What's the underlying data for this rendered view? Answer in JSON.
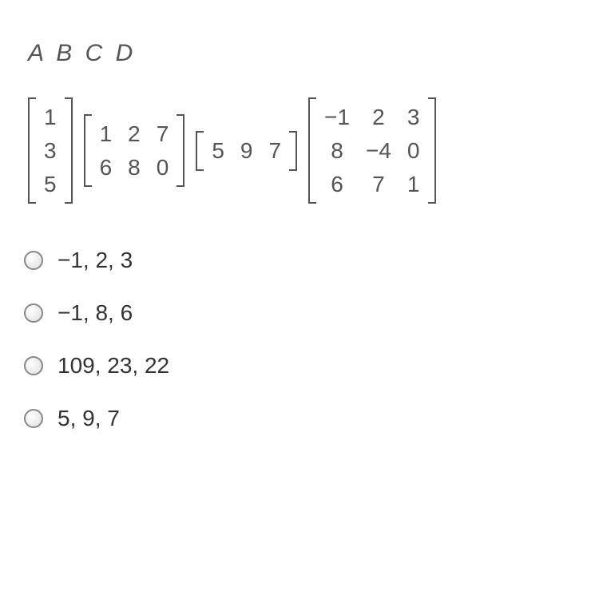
{
  "heading": "A B C D",
  "matrixA": [
    [
      "1"
    ],
    [
      "3"
    ],
    [
      "5"
    ]
  ],
  "matrixB": [
    [
      "1",
      "2",
      "7"
    ],
    [
      "6",
      "8",
      "0"
    ]
  ],
  "matrixC": [
    [
      "5",
      "9",
      "7"
    ]
  ],
  "matrixD": [
    [
      "−1",
      "2",
      "3"
    ],
    [
      "8",
      "−4",
      "0"
    ],
    [
      "6",
      "7",
      "1"
    ]
  ],
  "options": [
    "−1, 2, 3",
    "−1, 8, 6",
    "109, 23, 22",
    "5, 9, 7"
  ]
}
